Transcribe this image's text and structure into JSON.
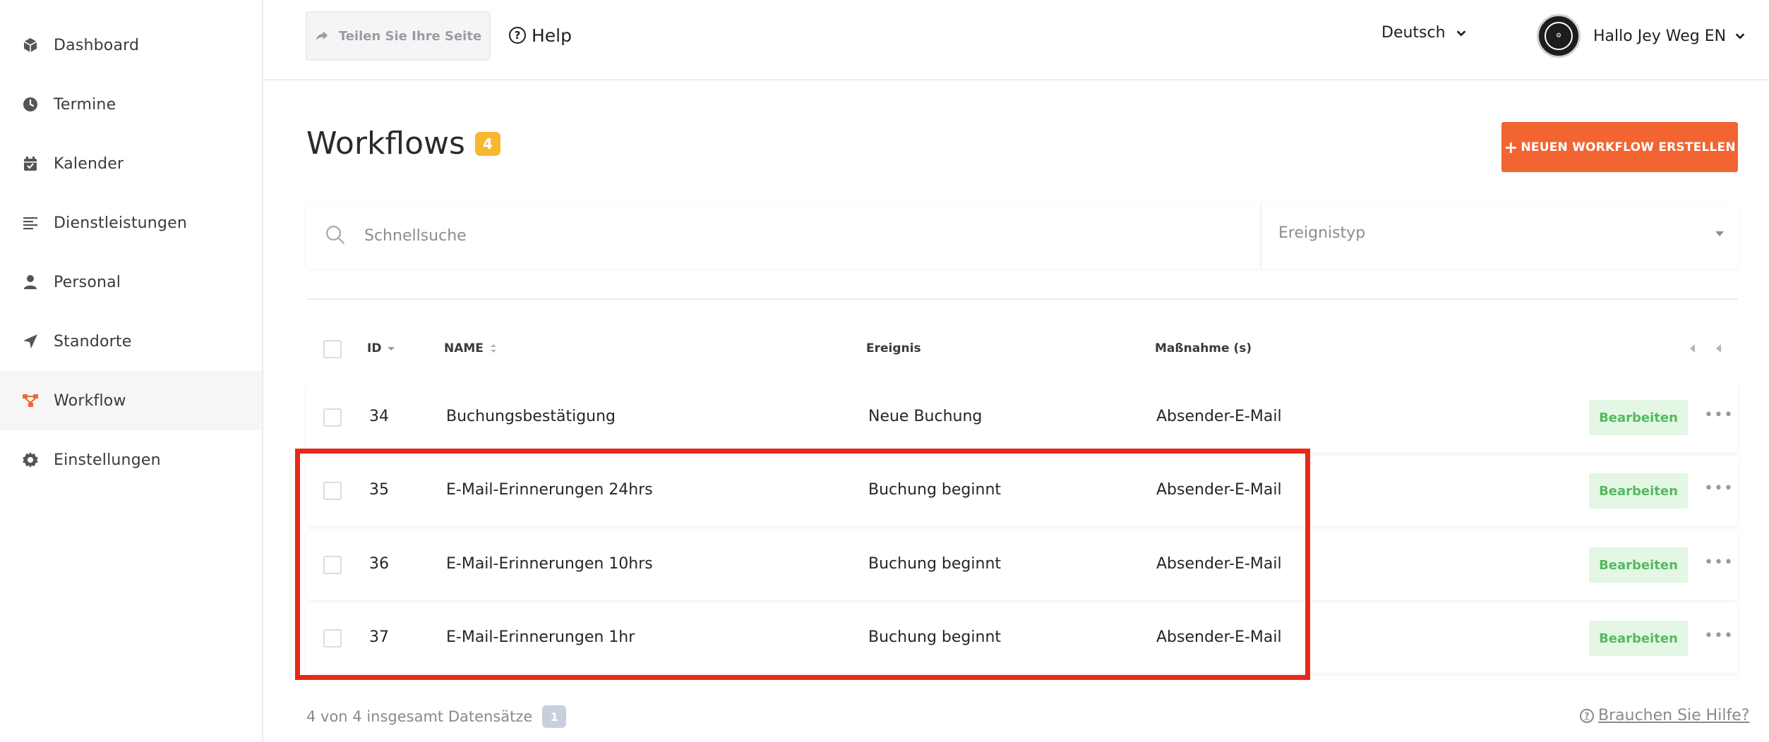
{
  "sidebar": {
    "items": [
      {
        "label": "Dashboard",
        "icon": "dashboard-icon"
      },
      {
        "label": "Termine",
        "icon": "clock-icon"
      },
      {
        "label": "Kalender",
        "icon": "calendar-icon"
      },
      {
        "label": "Dienstleistungen",
        "icon": "list-icon"
      },
      {
        "label": "Personal",
        "icon": "person-icon"
      },
      {
        "label": "Standorte",
        "icon": "location-arrow-icon"
      },
      {
        "label": "Workflow",
        "icon": "workflow-icon",
        "active": true
      },
      {
        "label": "Einstellungen",
        "icon": "gear-icon"
      }
    ]
  },
  "topbar": {
    "share_label": "Teilen Sie Ihre Seite",
    "help_label": "Help",
    "language": "Deutsch",
    "user_greeting": "Hallo Jey Weg EN"
  },
  "main": {
    "title": "Workflows",
    "count": "4",
    "create_button": "NEUEN WORKFLOW ERSTELLEN",
    "search_placeholder": "Schnellsuche",
    "event_type_placeholder": "Ereignistyp"
  },
  "table": {
    "columns": {
      "id": "ID",
      "name": "NAME",
      "event": "Ereignis",
      "action": "Maßnahme (s)"
    },
    "edit_label": "Bearbeiten",
    "more_label": "•••",
    "rows": [
      {
        "id": "34",
        "name": "Buchungsbestätigung",
        "event": "Neue Buchung",
        "action": "Absender-E-Mail"
      },
      {
        "id": "35",
        "name": "E-Mail-Erinnerungen 24hrs",
        "event": "Buchung beginnt",
        "action": "Absender-E-Mail"
      },
      {
        "id": "36",
        "name": "E-Mail-Erinnerungen 10hrs",
        "event": "Buchung beginnt",
        "action": "Absender-E-Mail"
      },
      {
        "id": "37",
        "name": "E-Mail-Erinnerungen 1hr",
        "event": "Buchung beginnt",
        "action": "Absender-E-Mail"
      }
    ]
  },
  "footer": {
    "records_text": "4 von 4 insgesamt Datensätze",
    "page": "1",
    "help_link": "Brauchen Sie Hilfe?"
  },
  "colors": {
    "accent": "#f26431",
    "badge": "#f7b733",
    "edit_bg": "#e3f7e4",
    "edit_text": "#54b95f",
    "highlight": "#e8281a"
  }
}
